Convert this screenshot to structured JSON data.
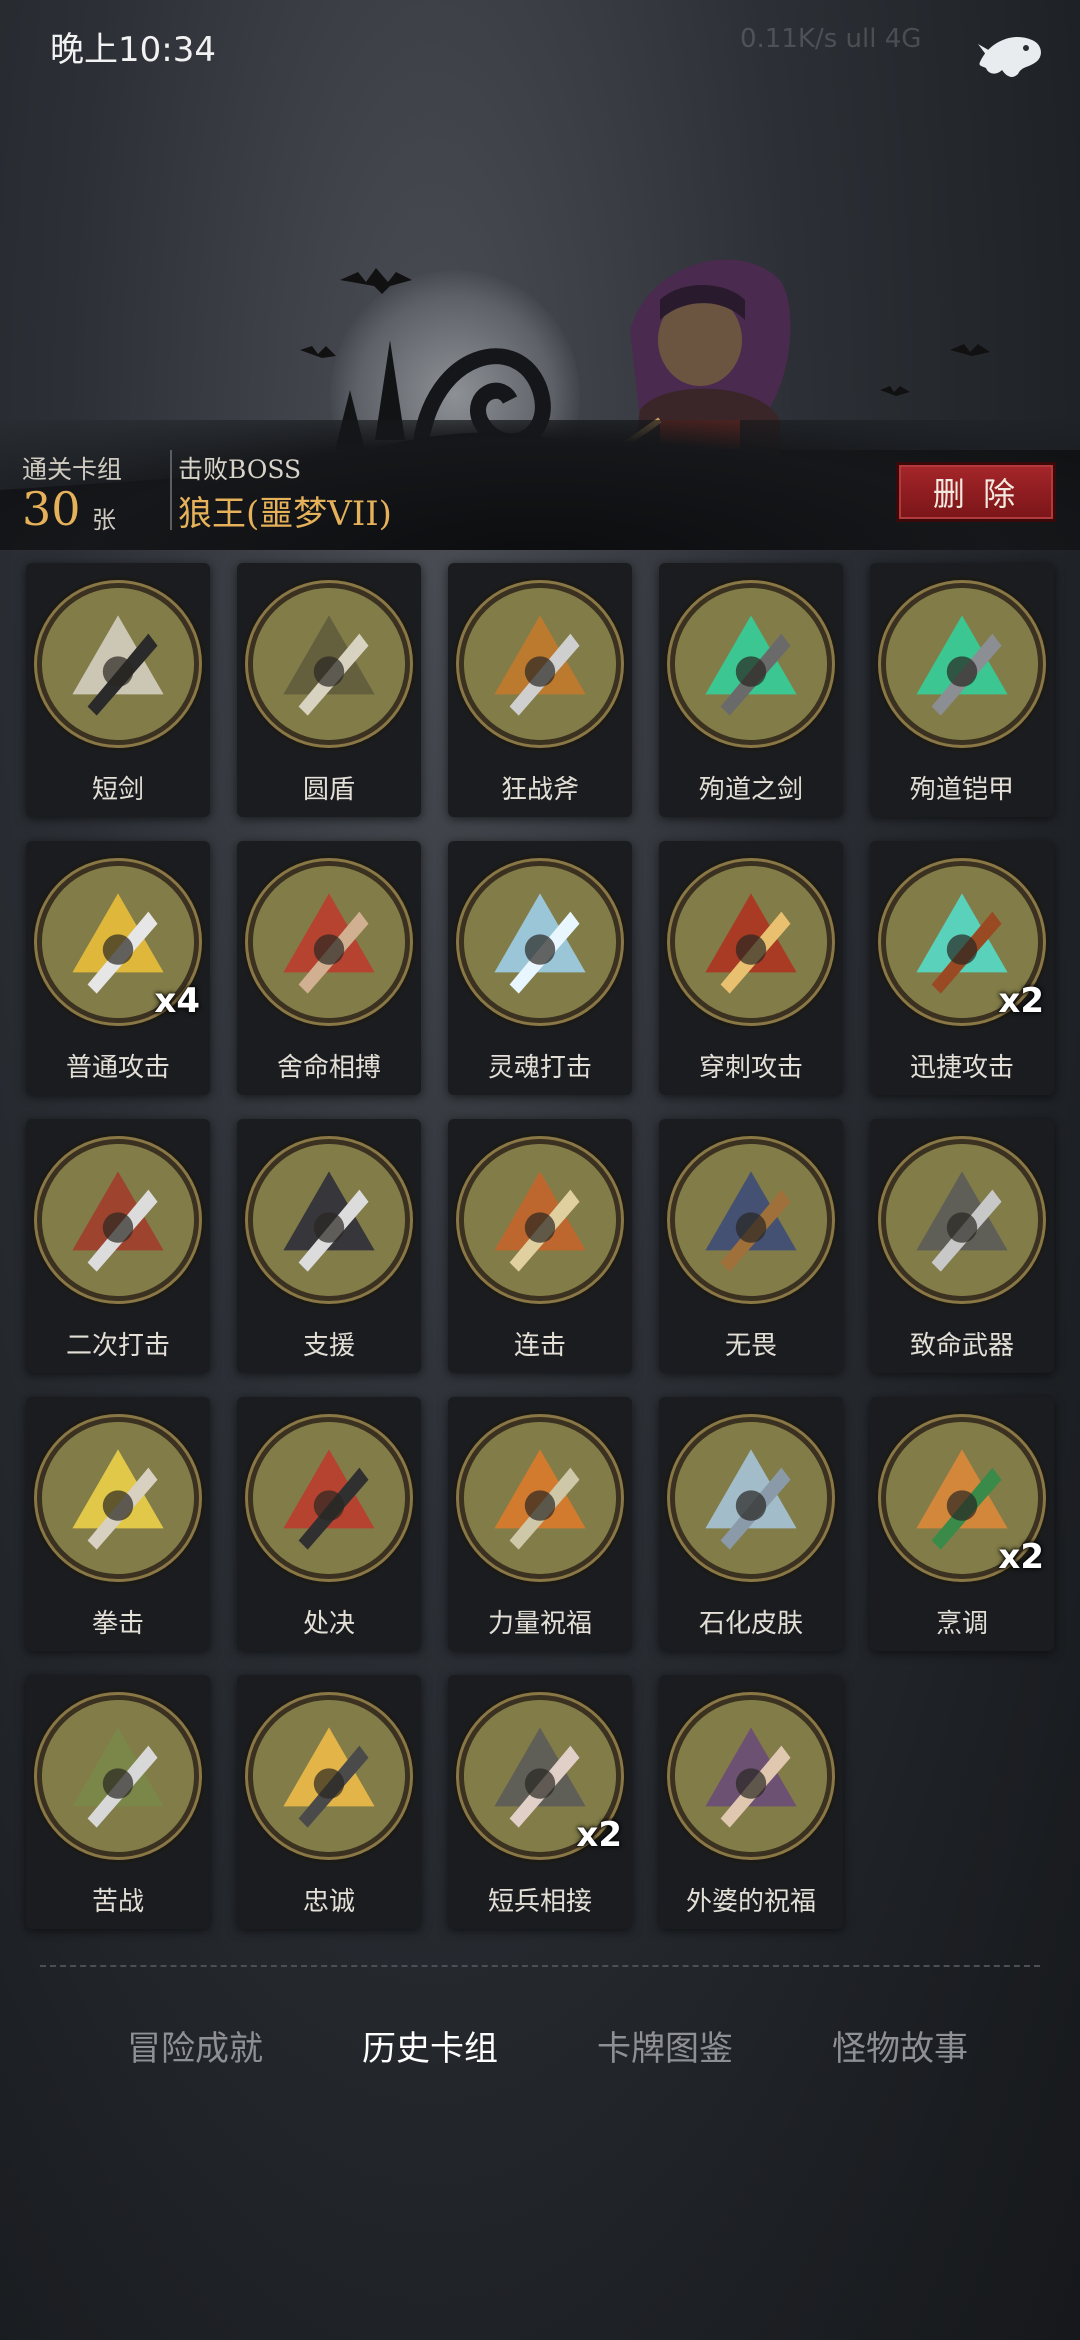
{
  "status": {
    "time": "晚上10:34",
    "right_info": "0.11K/s ull 4G"
  },
  "summary": {
    "deck_label": "通关卡组",
    "deck_count": "30",
    "deck_unit": "张",
    "boss_label": "击败BOSS",
    "boss_name": "狼王(噩梦VII)",
    "delete_label": "删 除"
  },
  "cards": [
    {
      "name": "短剑",
      "count": "",
      "icon": "dagger-icon"
    },
    {
      "name": "圆盾",
      "count": "",
      "icon": "skull-shield-icon"
    },
    {
      "name": "狂战斧",
      "count": "",
      "icon": "axe-icon"
    },
    {
      "name": "殉道之剑",
      "count": "",
      "icon": "green-flame-sword-icon"
    },
    {
      "name": "殉道铠甲",
      "count": "",
      "icon": "green-flame-armor-icon"
    },
    {
      "name": "普通攻击",
      "count": "x4",
      "icon": "sword-strike-icon"
    },
    {
      "name": "舍命相搏",
      "count": "",
      "icon": "desperate-hero-icon"
    },
    {
      "name": "灵魂打击",
      "count": "",
      "icon": "ice-shards-icon"
    },
    {
      "name": "穿刺攻击",
      "count": "",
      "icon": "spikes-icon"
    },
    {
      "name": "迅捷攻击",
      "count": "x2",
      "icon": "swift-gauntlet-icon"
    },
    {
      "name": "二次打击",
      "count": "",
      "icon": "double-strike-icon"
    },
    {
      "name": "支援",
      "count": "",
      "icon": "support-icon"
    },
    {
      "name": "连击",
      "count": "",
      "icon": "combo-archer-icon"
    },
    {
      "name": "无畏",
      "count": "",
      "icon": "fearless-icon"
    },
    {
      "name": "致命武器",
      "count": "",
      "icon": "weapons-icon"
    },
    {
      "name": "拳击",
      "count": "",
      "icon": "punch-skull-icon"
    },
    {
      "name": "处决",
      "count": "",
      "icon": "execution-icon"
    },
    {
      "name": "力量祝福",
      "count": "",
      "icon": "fist-icon"
    },
    {
      "name": "石化皮肤",
      "count": "",
      "icon": "stone-skin-icon"
    },
    {
      "name": "烹调",
      "count": "x2",
      "icon": "fox-chef-icon"
    },
    {
      "name": "苦战",
      "count": "",
      "icon": "hard-fight-icon"
    },
    {
      "name": "忠诚",
      "count": "",
      "icon": "cross-icon"
    },
    {
      "name": "短兵相接",
      "count": "x2",
      "icon": "knight-icon"
    },
    {
      "name": "外婆的祝福",
      "count": "",
      "icon": "grandma-icon"
    }
  ],
  "tabs": [
    {
      "label": "冒险成就",
      "active": false
    },
    {
      "label": "历史卡组",
      "active": true
    },
    {
      "label": "卡牌图鉴",
      "active": false
    },
    {
      "label": "怪物故事",
      "active": false
    }
  ],
  "colors": {
    "accent": "#e5b15a",
    "delete": "#9b2327",
    "card_bg": "#1a1c1f",
    "art_bg": "#7f7a48"
  }
}
